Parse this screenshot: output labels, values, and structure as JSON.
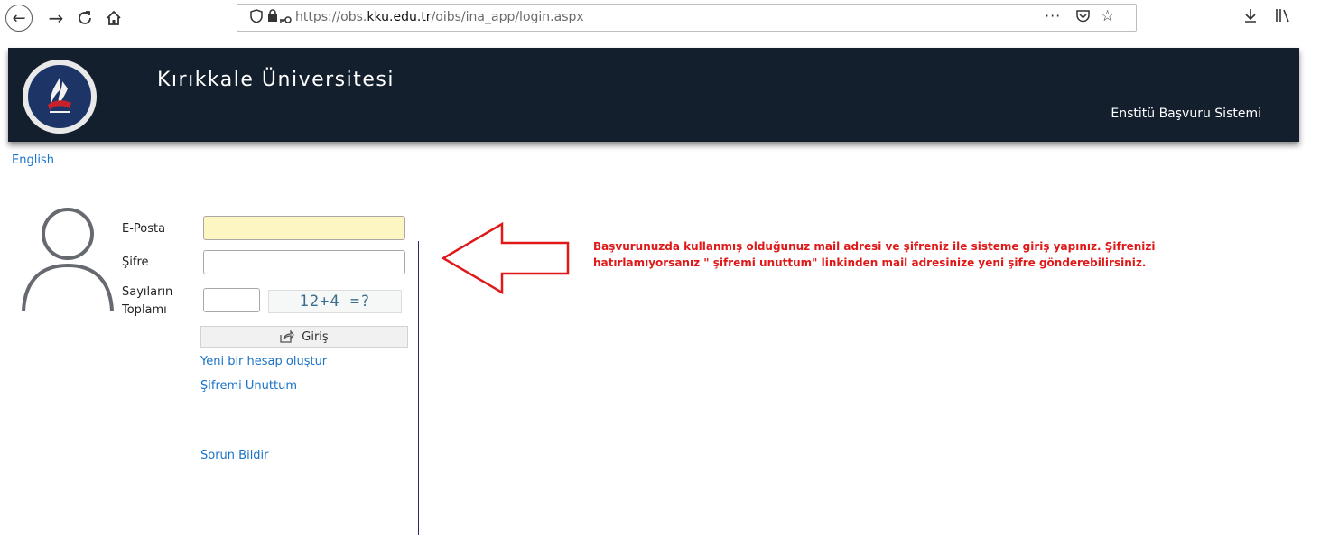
{
  "browser": {
    "url_prefix": "https://obs.",
    "url_domain": "kku.edu.tr",
    "url_path": "/oibs/ina_app/login.aspx",
    "icons": [
      "back-icon",
      "forward-icon",
      "reload-icon",
      "home-icon",
      "shield-icon",
      "lock-icon",
      "key-icon",
      "more-icon",
      "pocket-icon",
      "star-icon",
      "download-icon",
      "library-icon"
    ]
  },
  "header": {
    "university_name": "Kırıkkale Üniversitesi",
    "system_name": "Enstitü Başvuru Sistemi",
    "background": "#141f2d"
  },
  "language_link": "English",
  "login": {
    "email_label": "E-Posta",
    "email_value": "",
    "password_label": "Şifre",
    "password_value": "",
    "captcha_label_line1": "Sayıların",
    "captcha_label_line2": "Toplamı",
    "captcha_value": "",
    "captcha_text": "12+4 =?",
    "submit_label": "Giriş",
    "create_account_link": "Yeni bir hesap oluştur",
    "forgot_password_link": "Şifremi Unuttum",
    "report_issue_link": "Sorun Bildir"
  },
  "notice": {
    "text": "Başvurunuzda kullanmış olduğunuz mail adresi ve şifreniz ile  sisteme giriş yapınız. Şifrenizi hatırlamıyorsanız \" şifremi unuttum\" linkinden mail adresinize yeni şifre gönderebilirsiniz.",
    "color": "#e01818"
  },
  "colors": {
    "link": "#1a73c8",
    "email_field_bg": "#fdf6c3"
  }
}
